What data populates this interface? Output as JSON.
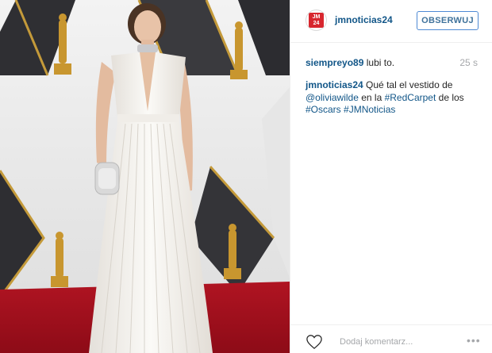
{
  "post": {
    "photo_alt": "photo",
    "header": {
      "avatar_line1": "JM",
      "avatar_line2": "24",
      "username": "jmnoticias24",
      "follow_label": "OBSERWUJ"
    },
    "likes": {
      "liker": "siempreyo89",
      "suffix": "lubi to."
    },
    "time_ago": "25 s",
    "caption": {
      "author": "jmnoticias24",
      "text_1": "Qué tal el vestido de",
      "mention": "@oliviawilde",
      "text_2": "en la",
      "tag_1": "#RedCarpet",
      "text_3": "de los",
      "tag_2": "#Oscars",
      "tag_3": "#JMNoticias"
    },
    "footer": {
      "comment_placeholder": "Dodaj komentarz...",
      "more_label": "•••"
    },
    "colors": {
      "link": "#125688",
      "follow_border": "#4f8ad4",
      "muted": "#a5a7aa",
      "carpet": "#a50f1c",
      "backdrop_gold": "#c49a3a"
    },
    "icons": {
      "like": "heart-outline-icon",
      "more": "ellipsis-icon"
    }
  }
}
